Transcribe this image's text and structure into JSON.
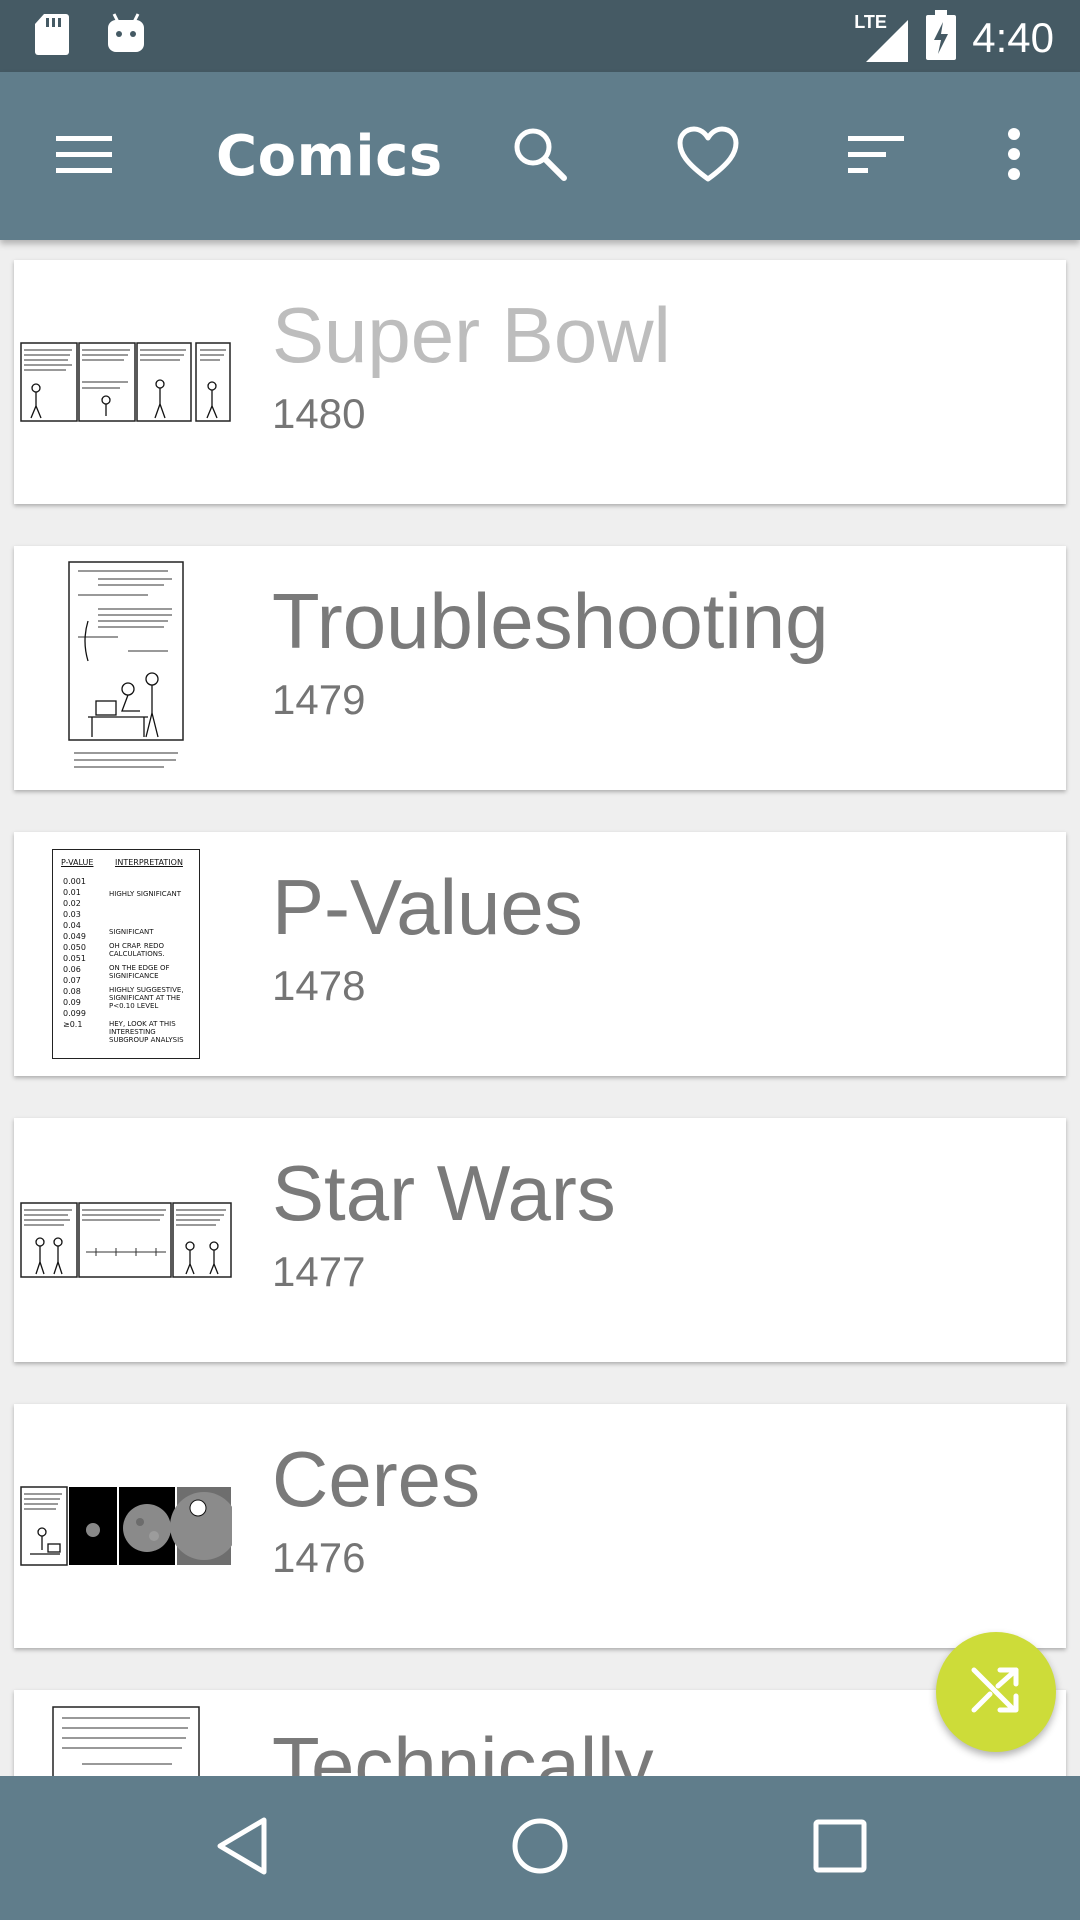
{
  "status_bar": {
    "time": "4:40",
    "network": "LTE",
    "icons": [
      "sd-card-icon",
      "android-icon",
      "signal-icon",
      "battery-charging-icon"
    ]
  },
  "app_bar": {
    "title": "Comics",
    "actions": [
      "menu-icon",
      "search-icon",
      "heart-icon",
      "sort-icon",
      "more-vert-icon"
    ]
  },
  "comics": [
    {
      "title": "Super Bowl",
      "number": "1480"
    },
    {
      "title": "Troubleshooting",
      "number": "1479"
    },
    {
      "title": "P-Values",
      "number": "1478"
    },
    {
      "title": "Star Wars",
      "number": "1477"
    },
    {
      "title": "Ceres",
      "number": "1476"
    },
    {
      "title": "Technically",
      "number": ""
    }
  ],
  "pvalue_thumb": {
    "header": [
      "P-VALUE",
      "INTERPRETATION"
    ],
    "values": [
      "0.001",
      "0.01",
      "0.02",
      "0.03",
      "0.04",
      "0.049",
      "0.050",
      "0.051",
      "0.06",
      "0.07",
      "0.08",
      "0.09",
      "0.099",
      "≥0.1"
    ],
    "labels": [
      "HIGHLY SIGNIFICANT",
      "SIGNIFICANT",
      "OH CRAP. REDO CALCULATIONS.",
      "ON THE EDGE OF SIGNIFICANCE",
      "HIGHLY SUGGESTIVE, SIGNIFICANT AT THE P<0.10 LEVEL",
      "HEY, LOOK AT THIS INTERESTING SUBGROUP ANALYSIS"
    ]
  },
  "fab": {
    "icon": "shuffle-icon"
  },
  "nav_bar": {
    "buttons": [
      "back-icon",
      "home-icon",
      "recents-icon"
    ]
  }
}
